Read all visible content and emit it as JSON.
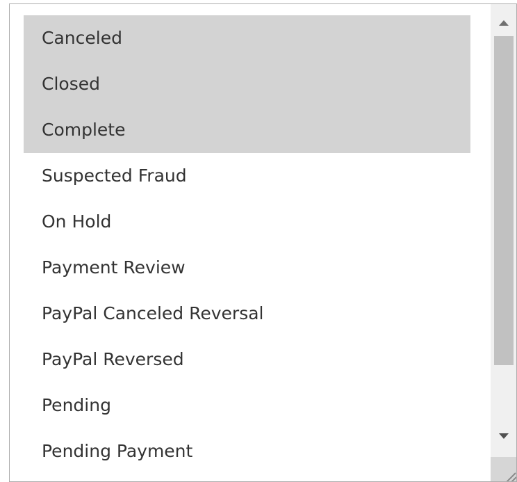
{
  "status_list": {
    "options": [
      {
        "label": "Canceled",
        "selected": true
      },
      {
        "label": "Closed",
        "selected": true
      },
      {
        "label": "Complete",
        "selected": true
      },
      {
        "label": "Suspected Fraud",
        "selected": false
      },
      {
        "label": "On Hold",
        "selected": false
      },
      {
        "label": "Payment Review",
        "selected": false
      },
      {
        "label": "PayPal Canceled Reversal",
        "selected": false
      },
      {
        "label": "PayPal Reversed",
        "selected": false
      },
      {
        "label": "Pending",
        "selected": false
      },
      {
        "label": "Pending Payment",
        "selected": false
      }
    ],
    "colors": {
      "selected_background": "#d3d3d3",
      "text": "#333333",
      "border": "#adadad"
    },
    "scrollbar": {
      "up_icon": "triangle-up-icon",
      "down_icon": "triangle-down-icon",
      "grip_icon": "resize-grip-icon"
    }
  }
}
